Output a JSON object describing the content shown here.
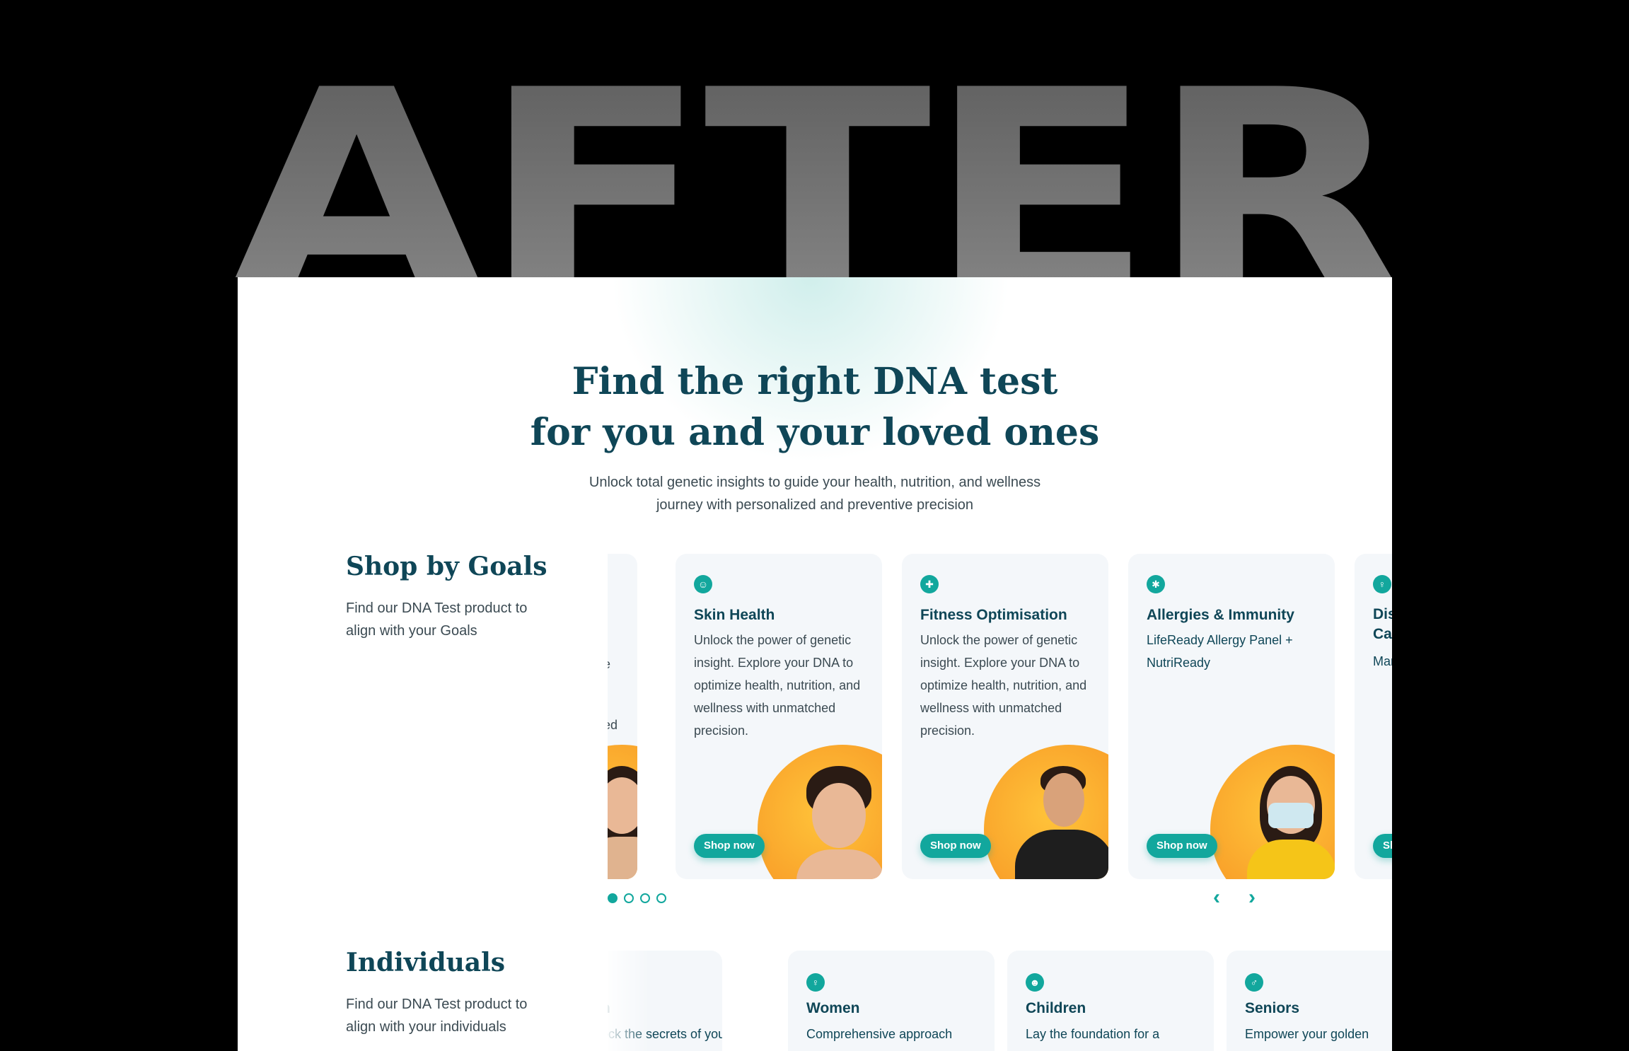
{
  "banner": {
    "word": "AFTER"
  },
  "hero": {
    "title_line1": "Find the right DNA test",
    "title_line2": "for you and your loved ones",
    "subtitle_line1": "Unlock total genetic insights to guide your health, nutrition, and wellness",
    "subtitle_line2": "journey with personalized and preventive precision"
  },
  "goals": {
    "title": "Shop by Goals",
    "desc": "Find our DNA Test product to align with your Goals",
    "partial_left_text": [
      "e",
      "ed"
    ],
    "cards": [
      {
        "icon": "face-icon",
        "title": "Skin Health",
        "desc": "Unlock the power of genetic insight. Explore your DNA to optimize health, nutrition, and wellness with unmatched precision.",
        "button": "Shop now"
      },
      {
        "icon": "dumbbell-icon",
        "title": "Fitness Optimisation",
        "desc": "Unlock the power of genetic insight. Explore your DNA to optimize health, nutrition, and wellness with unmatched precision.",
        "button": "Shop now"
      },
      {
        "icon": "virus-icon",
        "title": "Allergies & Immunity",
        "desc": "LifeReady Allergy Panel + NutriReady",
        "button": "Shop now"
      },
      {
        "icon": "ribbon-icon",
        "title": "Dis Car",
        "desc": "Mar",
        "button": "Sh"
      }
    ],
    "pagination": {
      "total": 4,
      "active": 0
    },
    "prev_arrow": "‹",
    "next_arrow": "›"
  },
  "individuals": {
    "title": "Individuals",
    "desc": "Find our DNA Test product to align with your individuals",
    "cards": [
      {
        "icon": "man-icon",
        "title": "n",
        "desc": "ock the secrets of your"
      },
      {
        "icon": "woman-icon",
        "title": "Women",
        "desc": "Comprehensive approach"
      },
      {
        "icon": "child-icon",
        "title": "Children",
        "desc": "Lay the foundation for a"
      },
      {
        "icon": "seniors-icon",
        "title": "Seniors",
        "desc": "Empower your golden"
      }
    ]
  },
  "colors": {
    "accent": "#12a79d",
    "heading": "#0f4657",
    "card_bg": "#f4f7fa",
    "blob": "#f7a52c"
  }
}
